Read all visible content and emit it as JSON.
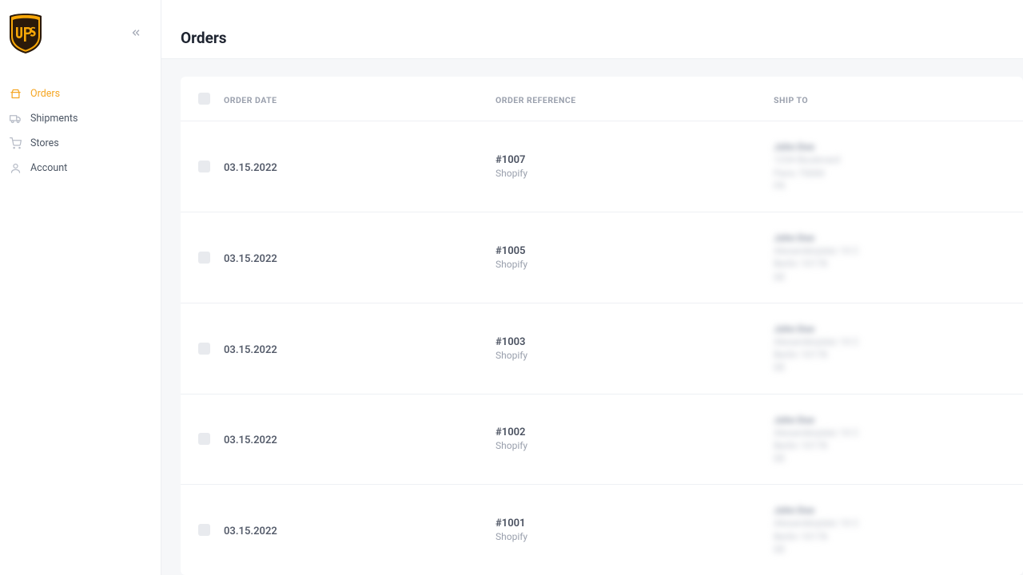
{
  "sidebar": {
    "items": [
      {
        "label": "Orders"
      },
      {
        "label": "Shipments"
      },
      {
        "label": "Stores"
      },
      {
        "label": "Account"
      }
    ]
  },
  "header": {
    "pageTitle": "Orders"
  },
  "table": {
    "headers": {
      "date": "Order Date",
      "ref": "Order Reference",
      "ship": "Ship To"
    },
    "rows": [
      {
        "date": "03.15.2022",
        "ref": "#1007",
        "source": "Shopify"
      },
      {
        "date": "03.15.2022",
        "ref": "#1005",
        "source": "Shopify"
      },
      {
        "date": "03.15.2022",
        "ref": "#1003",
        "source": "Shopify"
      },
      {
        "date": "03.15.2022",
        "ref": "#1002",
        "source": "Shopify"
      },
      {
        "date": "03.15.2022",
        "ref": "#1001",
        "source": "Shopify"
      }
    ]
  }
}
